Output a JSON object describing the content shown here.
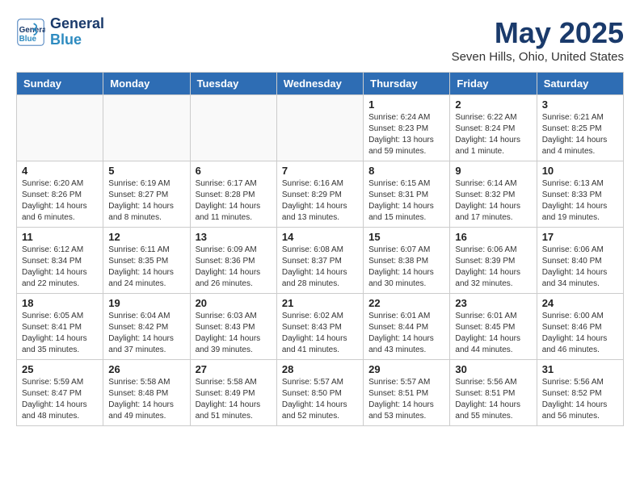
{
  "header": {
    "logo_line1": "General",
    "logo_line2": "Blue",
    "title": "May 2025",
    "subtitle": "Seven Hills, Ohio, United States"
  },
  "days_of_week": [
    "Sunday",
    "Monday",
    "Tuesday",
    "Wednesday",
    "Thursday",
    "Friday",
    "Saturday"
  ],
  "weeks": [
    [
      {
        "day": "",
        "info": ""
      },
      {
        "day": "",
        "info": ""
      },
      {
        "day": "",
        "info": ""
      },
      {
        "day": "",
        "info": ""
      },
      {
        "day": "1",
        "info": "Sunrise: 6:24 AM\nSunset: 8:23 PM\nDaylight: 13 hours and 59 minutes."
      },
      {
        "day": "2",
        "info": "Sunrise: 6:22 AM\nSunset: 8:24 PM\nDaylight: 14 hours and 1 minute."
      },
      {
        "day": "3",
        "info": "Sunrise: 6:21 AM\nSunset: 8:25 PM\nDaylight: 14 hours and 4 minutes."
      }
    ],
    [
      {
        "day": "4",
        "info": "Sunrise: 6:20 AM\nSunset: 8:26 PM\nDaylight: 14 hours and 6 minutes."
      },
      {
        "day": "5",
        "info": "Sunrise: 6:19 AM\nSunset: 8:27 PM\nDaylight: 14 hours and 8 minutes."
      },
      {
        "day": "6",
        "info": "Sunrise: 6:17 AM\nSunset: 8:28 PM\nDaylight: 14 hours and 11 minutes."
      },
      {
        "day": "7",
        "info": "Sunrise: 6:16 AM\nSunset: 8:29 PM\nDaylight: 14 hours and 13 minutes."
      },
      {
        "day": "8",
        "info": "Sunrise: 6:15 AM\nSunset: 8:31 PM\nDaylight: 14 hours and 15 minutes."
      },
      {
        "day": "9",
        "info": "Sunrise: 6:14 AM\nSunset: 8:32 PM\nDaylight: 14 hours and 17 minutes."
      },
      {
        "day": "10",
        "info": "Sunrise: 6:13 AM\nSunset: 8:33 PM\nDaylight: 14 hours and 19 minutes."
      }
    ],
    [
      {
        "day": "11",
        "info": "Sunrise: 6:12 AM\nSunset: 8:34 PM\nDaylight: 14 hours and 22 minutes."
      },
      {
        "day": "12",
        "info": "Sunrise: 6:11 AM\nSunset: 8:35 PM\nDaylight: 14 hours and 24 minutes."
      },
      {
        "day": "13",
        "info": "Sunrise: 6:09 AM\nSunset: 8:36 PM\nDaylight: 14 hours and 26 minutes."
      },
      {
        "day": "14",
        "info": "Sunrise: 6:08 AM\nSunset: 8:37 PM\nDaylight: 14 hours and 28 minutes."
      },
      {
        "day": "15",
        "info": "Sunrise: 6:07 AM\nSunset: 8:38 PM\nDaylight: 14 hours and 30 minutes."
      },
      {
        "day": "16",
        "info": "Sunrise: 6:06 AM\nSunset: 8:39 PM\nDaylight: 14 hours and 32 minutes."
      },
      {
        "day": "17",
        "info": "Sunrise: 6:06 AM\nSunset: 8:40 PM\nDaylight: 14 hours and 34 minutes."
      }
    ],
    [
      {
        "day": "18",
        "info": "Sunrise: 6:05 AM\nSunset: 8:41 PM\nDaylight: 14 hours and 35 minutes."
      },
      {
        "day": "19",
        "info": "Sunrise: 6:04 AM\nSunset: 8:42 PM\nDaylight: 14 hours and 37 minutes."
      },
      {
        "day": "20",
        "info": "Sunrise: 6:03 AM\nSunset: 8:43 PM\nDaylight: 14 hours and 39 minutes."
      },
      {
        "day": "21",
        "info": "Sunrise: 6:02 AM\nSunset: 8:43 PM\nDaylight: 14 hours and 41 minutes."
      },
      {
        "day": "22",
        "info": "Sunrise: 6:01 AM\nSunset: 8:44 PM\nDaylight: 14 hours and 43 minutes."
      },
      {
        "day": "23",
        "info": "Sunrise: 6:01 AM\nSunset: 8:45 PM\nDaylight: 14 hours and 44 minutes."
      },
      {
        "day": "24",
        "info": "Sunrise: 6:00 AM\nSunset: 8:46 PM\nDaylight: 14 hours and 46 minutes."
      }
    ],
    [
      {
        "day": "25",
        "info": "Sunrise: 5:59 AM\nSunset: 8:47 PM\nDaylight: 14 hours and 48 minutes."
      },
      {
        "day": "26",
        "info": "Sunrise: 5:58 AM\nSunset: 8:48 PM\nDaylight: 14 hours and 49 minutes."
      },
      {
        "day": "27",
        "info": "Sunrise: 5:58 AM\nSunset: 8:49 PM\nDaylight: 14 hours and 51 minutes."
      },
      {
        "day": "28",
        "info": "Sunrise: 5:57 AM\nSunset: 8:50 PM\nDaylight: 14 hours and 52 minutes."
      },
      {
        "day": "29",
        "info": "Sunrise: 5:57 AM\nSunset: 8:51 PM\nDaylight: 14 hours and 53 minutes."
      },
      {
        "day": "30",
        "info": "Sunrise: 5:56 AM\nSunset: 8:51 PM\nDaylight: 14 hours and 55 minutes."
      },
      {
        "day": "31",
        "info": "Sunrise: 5:56 AM\nSunset: 8:52 PM\nDaylight: 14 hours and 56 minutes."
      }
    ]
  ]
}
